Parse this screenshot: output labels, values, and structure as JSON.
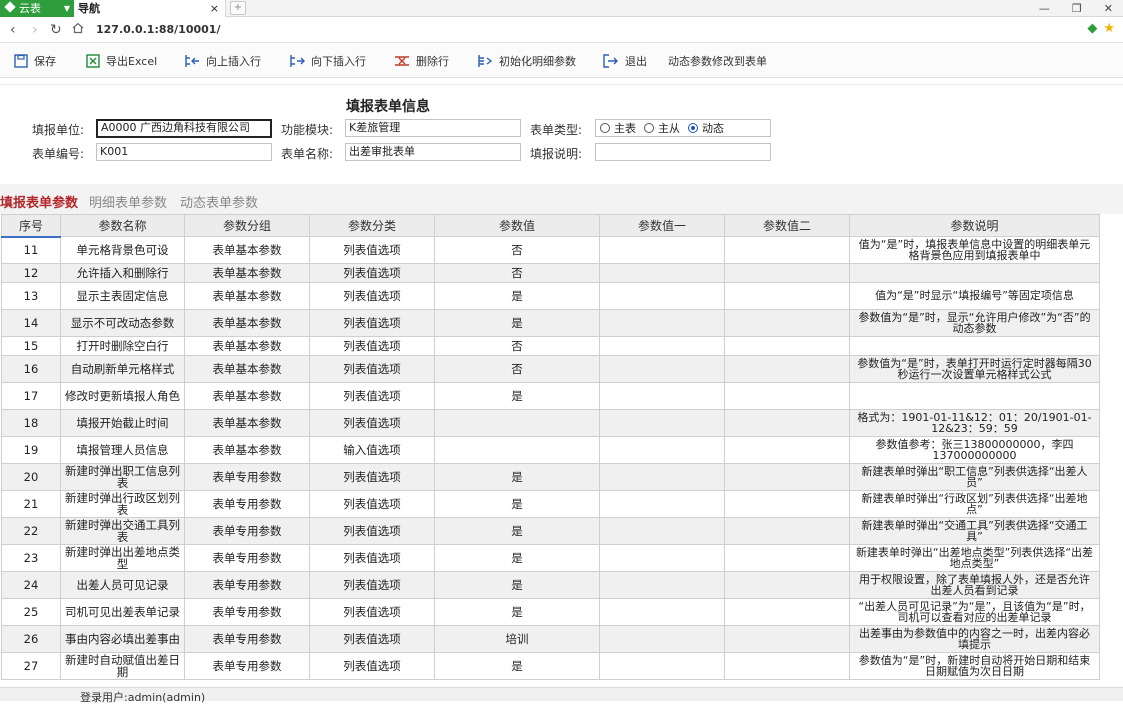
{
  "browser": {
    "brand": "云表",
    "tab_title": "导航",
    "tab_close": "×",
    "new_tab": "+",
    "url": "127.0.0.1:88/10001/",
    "win_min": "—",
    "win_restore": "❐",
    "win_close": "✕"
  },
  "toolbar": {
    "save": "保存",
    "export_excel": "导出Excel",
    "insert_above": "向上插入行",
    "insert_below": "向下插入行",
    "delete_row": "删除行",
    "init_params": "初始化明细参数",
    "exit": "退出",
    "dynamic_edit": "动态参数修改到表单"
  },
  "form": {
    "title": "填报表单信息",
    "unit_label": "填报单位:",
    "unit_value": "A0000 广西边角科技有限公司",
    "module_label": "功能模块:",
    "module_value": "K差旅管理",
    "type_label": "表单类型:",
    "type_options": [
      "主表",
      "主从",
      "动态"
    ],
    "type_selected": "动态",
    "code_label": "表单编号:",
    "code_value": "K001",
    "name_label": "表单名称:",
    "name_value": "出差审批表单",
    "note_label": "填报说明:",
    "note_value": ""
  },
  "subtabs": [
    "填报表单参数",
    "明细表单参数",
    "动态表单参数"
  ],
  "table": {
    "headers": [
      "序号",
      "参数名称",
      "参数分组",
      "参数分类",
      "参数值",
      "参数值一",
      "参数值二",
      "参数说明"
    ],
    "rows": [
      [
        "11",
        "单元格背景色可设",
        "表单基本参数",
        "列表值选项",
        "否",
        "",
        "",
        "值为“是”时，填报表单信息中设置的明细表单元格背景色应用到填报表单中"
      ],
      [
        "12",
        "允许插入和删除行",
        "表单基本参数",
        "列表值选项",
        "否",
        "",
        "",
        ""
      ],
      [
        "13",
        "显示主表固定信息",
        "表单基本参数",
        "列表值选项",
        "是",
        "",
        "",
        "值为“是”时显示“填报编号”等固定项信息"
      ],
      [
        "14",
        "显示不可改动态参数",
        "表单基本参数",
        "列表值选项",
        "是",
        "",
        "",
        "参数值为“是”时，显示“允许用户修改”为“否”的动态参数"
      ],
      [
        "15",
        "打开时删除空白行",
        "表单基本参数",
        "列表值选项",
        "否",
        "",
        "",
        ""
      ],
      [
        "16",
        "自动刷新单元格样式",
        "表单基本参数",
        "列表值选项",
        "否",
        "",
        "",
        "参数值为“是”时，表单打开时运行定时器每隔30秒运行一次设置单元格样式公式"
      ],
      [
        "17",
        "修改时更新填报人角色",
        "表单基本参数",
        "列表值选项",
        "是",
        "",
        "",
        ""
      ],
      [
        "18",
        "填报开始截止时间",
        "表单基本参数",
        "列表值选项",
        "",
        "",
        "",
        "格式为：1901-01-11&12：01：20/1901-01-12&23：59：59"
      ],
      [
        "19",
        "填报管理人员信息",
        "表单基本参数",
        "输入值选项",
        "",
        "",
        "",
        "参数值参考：张三13800000000，李四137000000000"
      ],
      [
        "20",
        "新建时弹出职工信息列表",
        "表单专用参数",
        "列表值选项",
        "是",
        "",
        "",
        "新建表单时弹出“职工信息”列表供选择“出差人员”"
      ],
      [
        "21",
        "新建时弹出行政区划列表",
        "表单专用参数",
        "列表值选项",
        "是",
        "",
        "",
        "新建表单时弹出“行政区划”列表供选择“出差地点”"
      ],
      [
        "22",
        "新建时弹出交通工具列表",
        "表单专用参数",
        "列表值选项",
        "是",
        "",
        "",
        "新建表单时弹出“交通工具”列表供选择“交通工具”"
      ],
      [
        "23",
        "新建时弹出出差地点类型",
        "表单专用参数",
        "列表值选项",
        "是",
        "",
        "",
        "新建表单时弹出“出差地点类型”列表供选择“出差地点类型”"
      ],
      [
        "24",
        "出差人员可见记录",
        "表单专用参数",
        "列表值选项",
        "是",
        "",
        "",
        "用于权限设置，除了表单填报人外，还是否允许出差人员看到记录"
      ],
      [
        "25",
        "司机可见出差表单记录",
        "表单专用参数",
        "列表值选项",
        "是",
        "",
        "",
        "“出差人员可见记录”为“是”，且该值为“是”时，司机可以查看对应的出差单记录"
      ],
      [
        "26",
        "事由内容必填出差事由",
        "表单专用参数",
        "列表值选项",
        "培训",
        "",
        "",
        "出差事由为参数值中的内容之一时，出差内容必填提示"
      ],
      [
        "27",
        "新建时自动赋值出差日期",
        "表单专用参数",
        "列表值选项",
        "是",
        "",
        "",
        "参数值为“是”时，新建时自动将开始日期和结束日期赋值为次日日期"
      ]
    ]
  },
  "status": {
    "user": "登录用户:admin(admin)"
  }
}
